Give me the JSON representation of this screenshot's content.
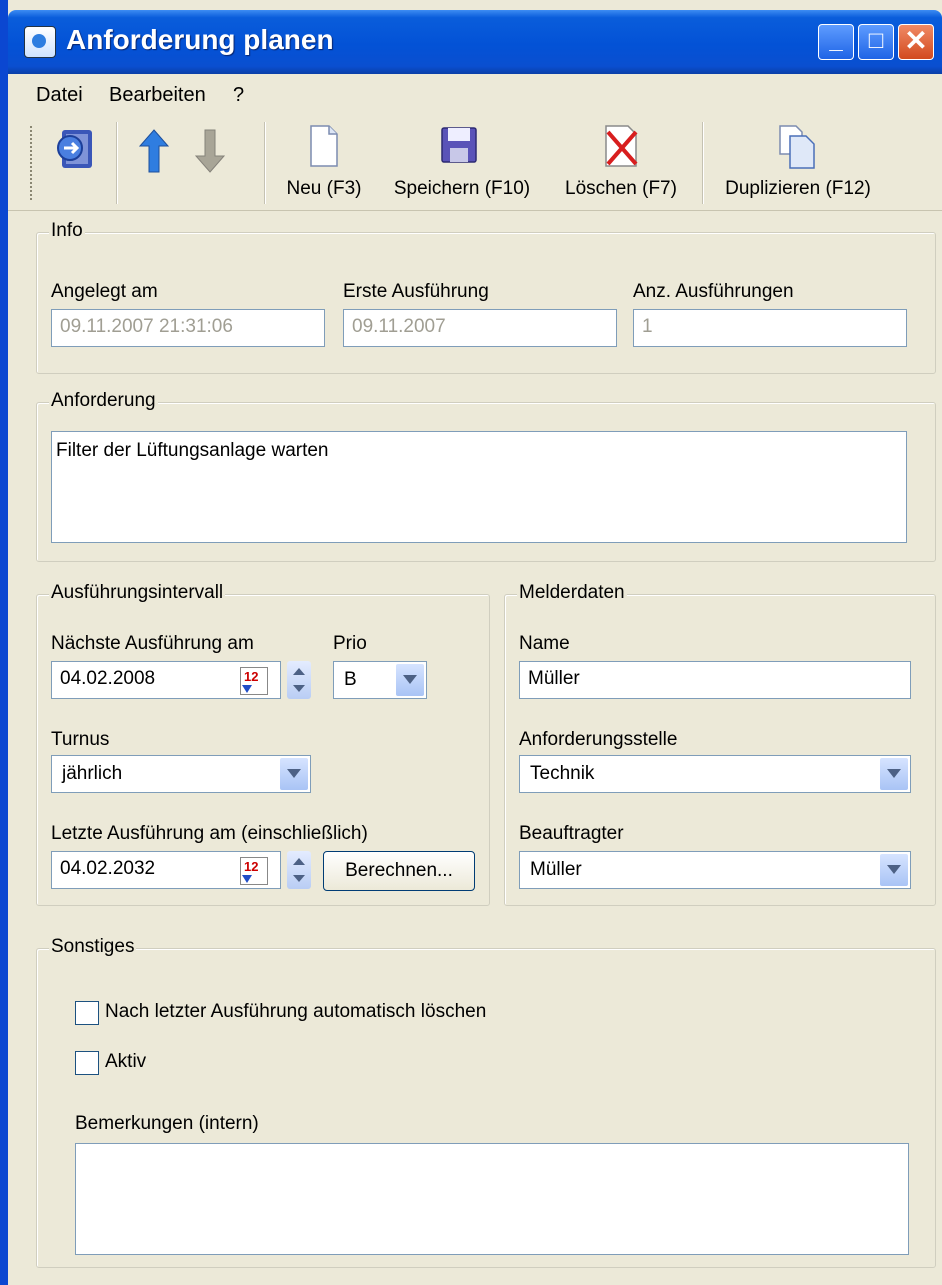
{
  "window": {
    "title": "Anforderung planen"
  },
  "menu": [
    "Datei",
    "Bearbeiten",
    "?"
  ],
  "toolbar": {
    "new": "Neu (F3)",
    "save": "Speichern (F10)",
    "delete": "Löschen (F7)",
    "duplicate": "Duplizieren (F12)"
  },
  "info": {
    "group": "Info",
    "created_label": "Angelegt am",
    "created_value": "09.11.2007 21:31:06",
    "first_label": "Erste Ausführung",
    "first_value": "09.11.2007",
    "count_label": "Anz. Ausführungen",
    "count_value": "1"
  },
  "requirement": {
    "group": "Anforderung",
    "text": "Filter der Lüftungsanlage warten"
  },
  "interval": {
    "group": "Ausführungsintervall",
    "next_label": "Nächste Ausführung am",
    "next_value": "04.02.2008",
    "prio_label": "Prio",
    "prio_value": "B",
    "turnus_label": "Turnus",
    "turnus_value": "jährlich",
    "last_label": "Letzte Ausführung am (einschließlich)",
    "last_value": "04.02.2032",
    "calc_button": "Berechnen..."
  },
  "reporter": {
    "group": "Melderdaten",
    "name_label": "Name",
    "name_value": "Müller",
    "dept_label": "Anforderungsstelle",
    "dept_value": "Technik",
    "agent_label": "Beauftragter",
    "agent_value": "Müller"
  },
  "misc": {
    "group": "Sonstiges",
    "autodelete_label": "Nach letzter Ausführung automatisch löschen",
    "active_label": "Aktiv",
    "notes_label": "Bemerkungen (intern)",
    "notes_value": ""
  }
}
